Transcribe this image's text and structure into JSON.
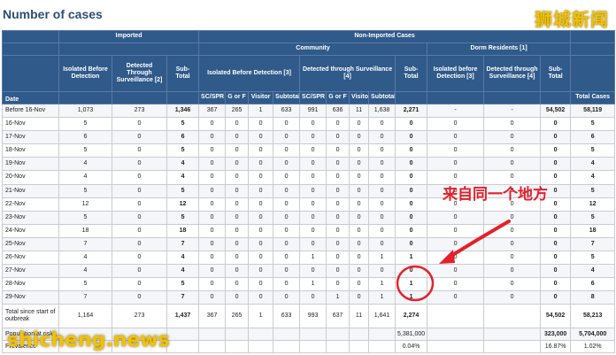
{
  "page": {
    "title": "Number of cases",
    "watermark_top": "狮城新闻",
    "watermark_bottom": "shicheng.news",
    "annotation": "来自同一个地方",
    "colors": {
      "header_bg": "#2f5a8a",
      "annotation": "#e5202a",
      "watermark": "#f2c200"
    }
  },
  "table": {
    "groups": {
      "imported": "Imported",
      "non_imported": "Non-Imported Cases",
      "community": "Community",
      "dorm": "Dorm Residents [1]"
    },
    "subheaders": {
      "imp_isolated": "Isolated Before Detection",
      "imp_detected": "Detected Through Surveillance [2]",
      "imp_subtotal": "Sub-Total",
      "com_isolated": "Isolated Before Detection [3]",
      "com_detected": "Detected through Surveillance [4]",
      "ni_subtotal": "Sub-Total",
      "dorm_isolated": "Isolated before Detection [3]",
      "dorm_detected": "Detected through Surveillance [4]",
      "dorm_subtotal": "Sub-Total"
    },
    "leaf": {
      "date": "Date",
      "sc1": "SC/SPR",
      "gf1": "G or F",
      "vis1": "Visitor",
      "sub1": "Subtotal",
      "sc2": "SC/SPR",
      "gf2": "G or F",
      "vis2": "Visitor",
      "sub2": "Subtotal",
      "total": "Total Cases"
    },
    "rows": [
      [
        "Before 16-Nov",
        "1,073",
        "273",
        "1,346",
        "367",
        "265",
        "1",
        "633",
        "991",
        "636",
        "11",
        "1,638",
        "2,271",
        "-",
        "-",
        "54,502",
        "58,119"
      ],
      [
        "16-Nov",
        "5",
        "0",
        "5",
        "0",
        "0",
        "0",
        "0",
        "0",
        "0",
        "0",
        "0",
        "0",
        "0",
        "0",
        "0",
        "5"
      ],
      [
        "17-Nov",
        "6",
        "0",
        "6",
        "0",
        "0",
        "0",
        "0",
        "0",
        "0",
        "0",
        "0",
        "0",
        "0",
        "0",
        "0",
        "6"
      ],
      [
        "18-Nov",
        "5",
        "0",
        "5",
        "0",
        "0",
        "0",
        "0",
        "0",
        "0",
        "0",
        "0",
        "0",
        "0",
        "0",
        "0",
        "5"
      ],
      [
        "19-Nov",
        "4",
        "0",
        "4",
        "0",
        "0",
        "0",
        "0",
        "0",
        "0",
        "0",
        "0",
        "0",
        "0",
        "0",
        "0",
        "4"
      ],
      [
        "20-Nov",
        "4",
        "0",
        "4",
        "0",
        "0",
        "0",
        "0",
        "0",
        "0",
        "0",
        "0",
        "0",
        "0",
        "0",
        "0",
        "4"
      ],
      [
        "21-Nov",
        "5",
        "0",
        "5",
        "0",
        "0",
        "0",
        "0",
        "0",
        "0",
        "0",
        "0",
        "0",
        "0",
        "0",
        "0",
        "5"
      ],
      [
        "22-Nov",
        "12",
        "0",
        "12",
        "0",
        "0",
        "0",
        "0",
        "0",
        "0",
        "0",
        "0",
        "0",
        "0",
        "0",
        "0",
        "12"
      ],
      [
        "23-Nov",
        "5",
        "0",
        "5",
        "0",
        "0",
        "0",
        "0",
        "0",
        "0",
        "0",
        "0",
        "0",
        "0",
        "0",
        "0",
        "5"
      ],
      [
        "24-Nov",
        "18",
        "0",
        "18",
        "0",
        "0",
        "0",
        "0",
        "0",
        "0",
        "0",
        "0",
        "0",
        "0",
        "0",
        "0",
        "18"
      ],
      [
        "25-Nov",
        "7",
        "0",
        "7",
        "0",
        "0",
        "0",
        "0",
        "0",
        "0",
        "0",
        "0",
        "0",
        "0",
        "0",
        "0",
        "7"
      ],
      [
        "26-Nov",
        "4",
        "0",
        "4",
        "0",
        "0",
        "0",
        "0",
        "1",
        "0",
        "0",
        "1",
        "1",
        "0",
        "0",
        "0",
        "5"
      ],
      [
        "27-Nov",
        "4",
        "0",
        "4",
        "0",
        "0",
        "0",
        "0",
        "0",
        "0",
        "0",
        "0",
        "0",
        "0",
        "0",
        "0",
        "4"
      ],
      [
        "28-Nov",
        "5",
        "0",
        "5",
        "0",
        "0",
        "0",
        "0",
        "1",
        "0",
        "0",
        "1",
        "1",
        "0",
        "0",
        "0",
        "6"
      ],
      [
        "29-Nov",
        "7",
        "0",
        "7",
        "0",
        "0",
        "0",
        "0",
        "0",
        "1",
        "0",
        "1",
        "1",
        "0",
        "0",
        "0",
        "8"
      ]
    ],
    "total_row": [
      "Total since start of outbreak",
      "1,164",
      "273",
      "1,437",
      "367",
      "265",
      "1",
      "633",
      "993",
      "637",
      "11",
      "1,641",
      "2,274",
      "",
      "",
      "54,502",
      "58,213"
    ],
    "population_row": {
      "label": "Population at risk",
      "ni_subtotal": "5,381,000",
      "dorm_subtotal": "323,000",
      "total": "5,704,000"
    },
    "prevalence_row": {
      "label": "Prevalence",
      "ni_subtotal": "0.04%",
      "dorm_subtotal": "16.87%",
      "total": "1.02%"
    }
  }
}
